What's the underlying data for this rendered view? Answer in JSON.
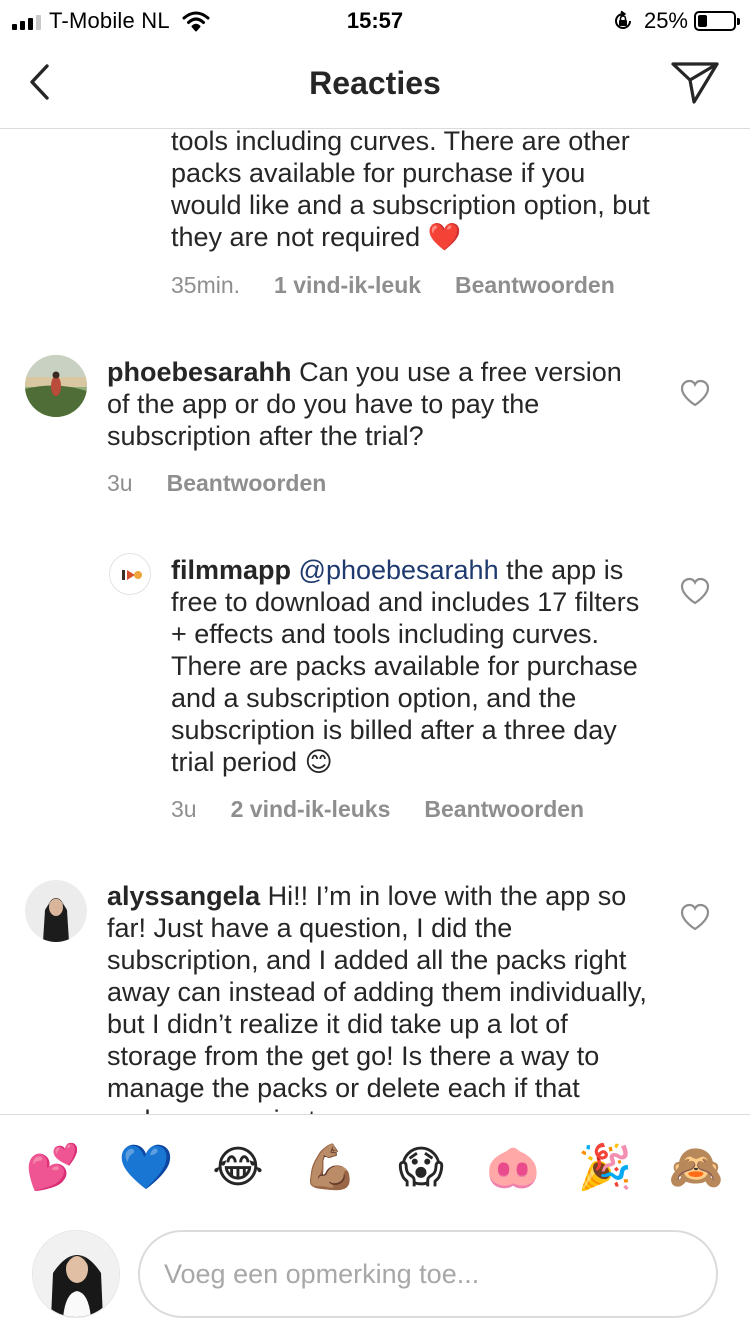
{
  "status_bar": {
    "carrier": "T-Mobile NL",
    "time": "15:57",
    "battery_percent": "25%",
    "battery_level": 0.25
  },
  "nav": {
    "title": "Reacties",
    "back_icon": "chevron-left-icon",
    "send_icon": "paper-plane-icon"
  },
  "comments": [
    {
      "text": "tools including curves. There are other packs available for purchase if you would like and a subscription option, but they are not required ❤️",
      "time": "35min.",
      "likes": "1 vind-ik-leuk",
      "reply": "Beantwoorden"
    },
    {
      "username": "phoebesarahh",
      "text": "Can you use a free version of the app or do you have to pay the subscription after the trial?",
      "time": "3u",
      "reply": "Beantwoorden"
    },
    {
      "username": "filmmapp",
      "mention": "@phoebesarahh",
      "text": "the app is free to download and includes 17 filters + effects and tools including curves. There are packs available for purchase and a subscription option, and the subscription is billed after a three day trial period 😊",
      "time": "3u",
      "likes": "2 vind-ik-leuks",
      "reply": "Beantwoorden"
    },
    {
      "username": "alyssangela",
      "text": "Hi!! I’m in love with the app so far! Just have a question, I did the subscription, and I added all the packs right away can instead of adding them individually, but I didn’t realize it did take up a lot of storage from the get go! Is there a way to manage the packs or delete each if that makes sense just"
    }
  ],
  "emojis": [
    "💕",
    "💙",
    "😂",
    "💪🏽",
    "😱",
    "🐽",
    "🎉",
    "🙈"
  ],
  "composer": {
    "placeholder": "Voeg een opmerking toe..."
  }
}
